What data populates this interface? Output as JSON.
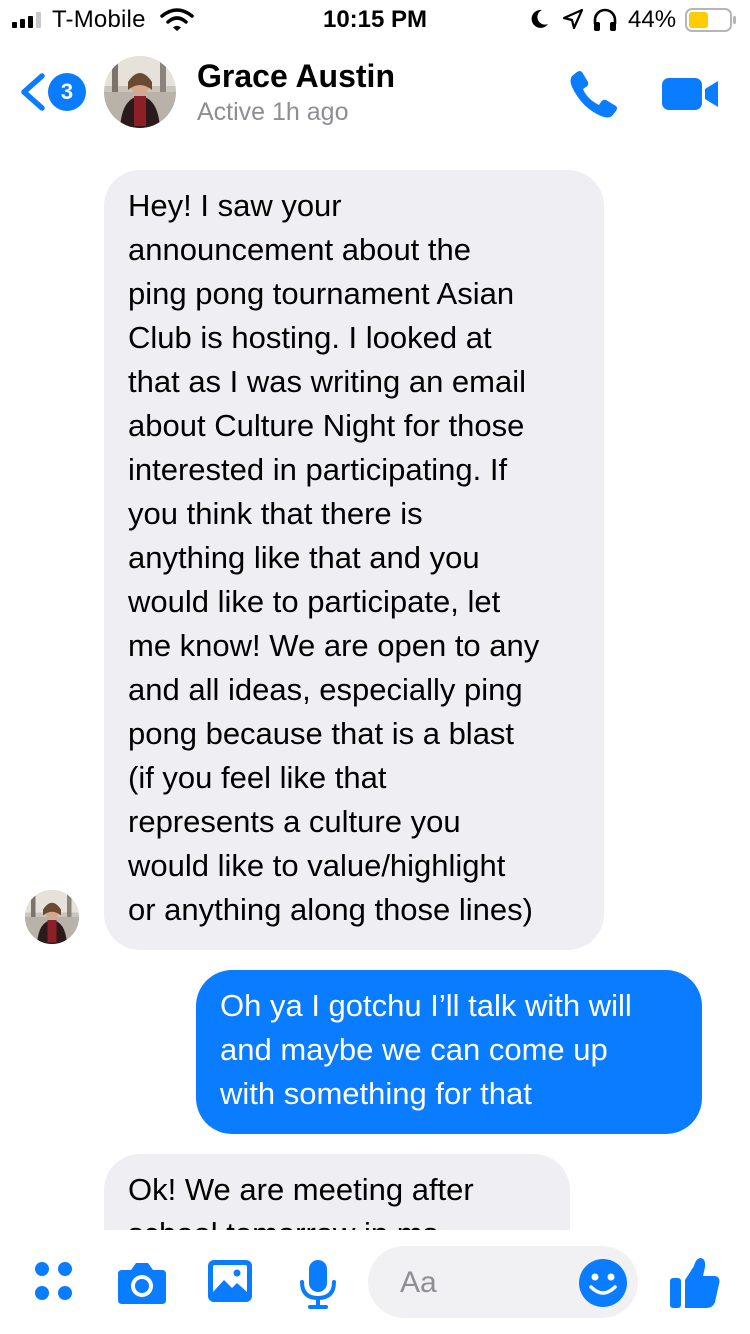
{
  "status_bar": {
    "carrier": "T-Mobile",
    "time": "10:15 PM",
    "battery_percent": "44%",
    "icons": [
      "signal-icon",
      "wifi-icon",
      "moon-icon",
      "location-arrow-icon",
      "headphones-icon",
      "battery-icon"
    ]
  },
  "header": {
    "unread_count": "3",
    "contact_name": "Grace Austin",
    "contact_status": "Active 1h ago",
    "icons": [
      "back-chevron-icon",
      "phone-icon",
      "video-camera-icon"
    ]
  },
  "messages": [
    {
      "direction": "incoming",
      "text": "Hey! I saw your\nannouncement about the\nping pong tournament Asian\nClub is hosting. I looked at\nthat as I was writing an email\nabout Culture Night for those\ninterested in participating. If\nyou think that there is\nanything like that and you\nwould like to participate, let\nme know! We are open to any\nand all ideas, especially ping\npong because that is a blast\n(if you feel like that\nrepresents a culture you\nwould like to value/highlight\nor anything along those lines)"
    },
    {
      "direction": "outgoing",
      "text": "Oh ya I gotchu I’ll talk with will\nand maybe we can come up\nwith something for that"
    },
    {
      "direction": "incoming",
      "text": "Ok! We are meeting after\nschool tomorrow in ms"
    }
  ],
  "composer": {
    "placeholder": "Aa",
    "icons": [
      "apps-grid-icon",
      "camera-icon",
      "image-icon",
      "microphone-icon",
      "emoji-icon",
      "thumbs-up-icon"
    ]
  },
  "colors": {
    "accent": "#0a7cff",
    "incoming_bubble": "#efeff3",
    "secondary_text": "#8e8e93"
  }
}
